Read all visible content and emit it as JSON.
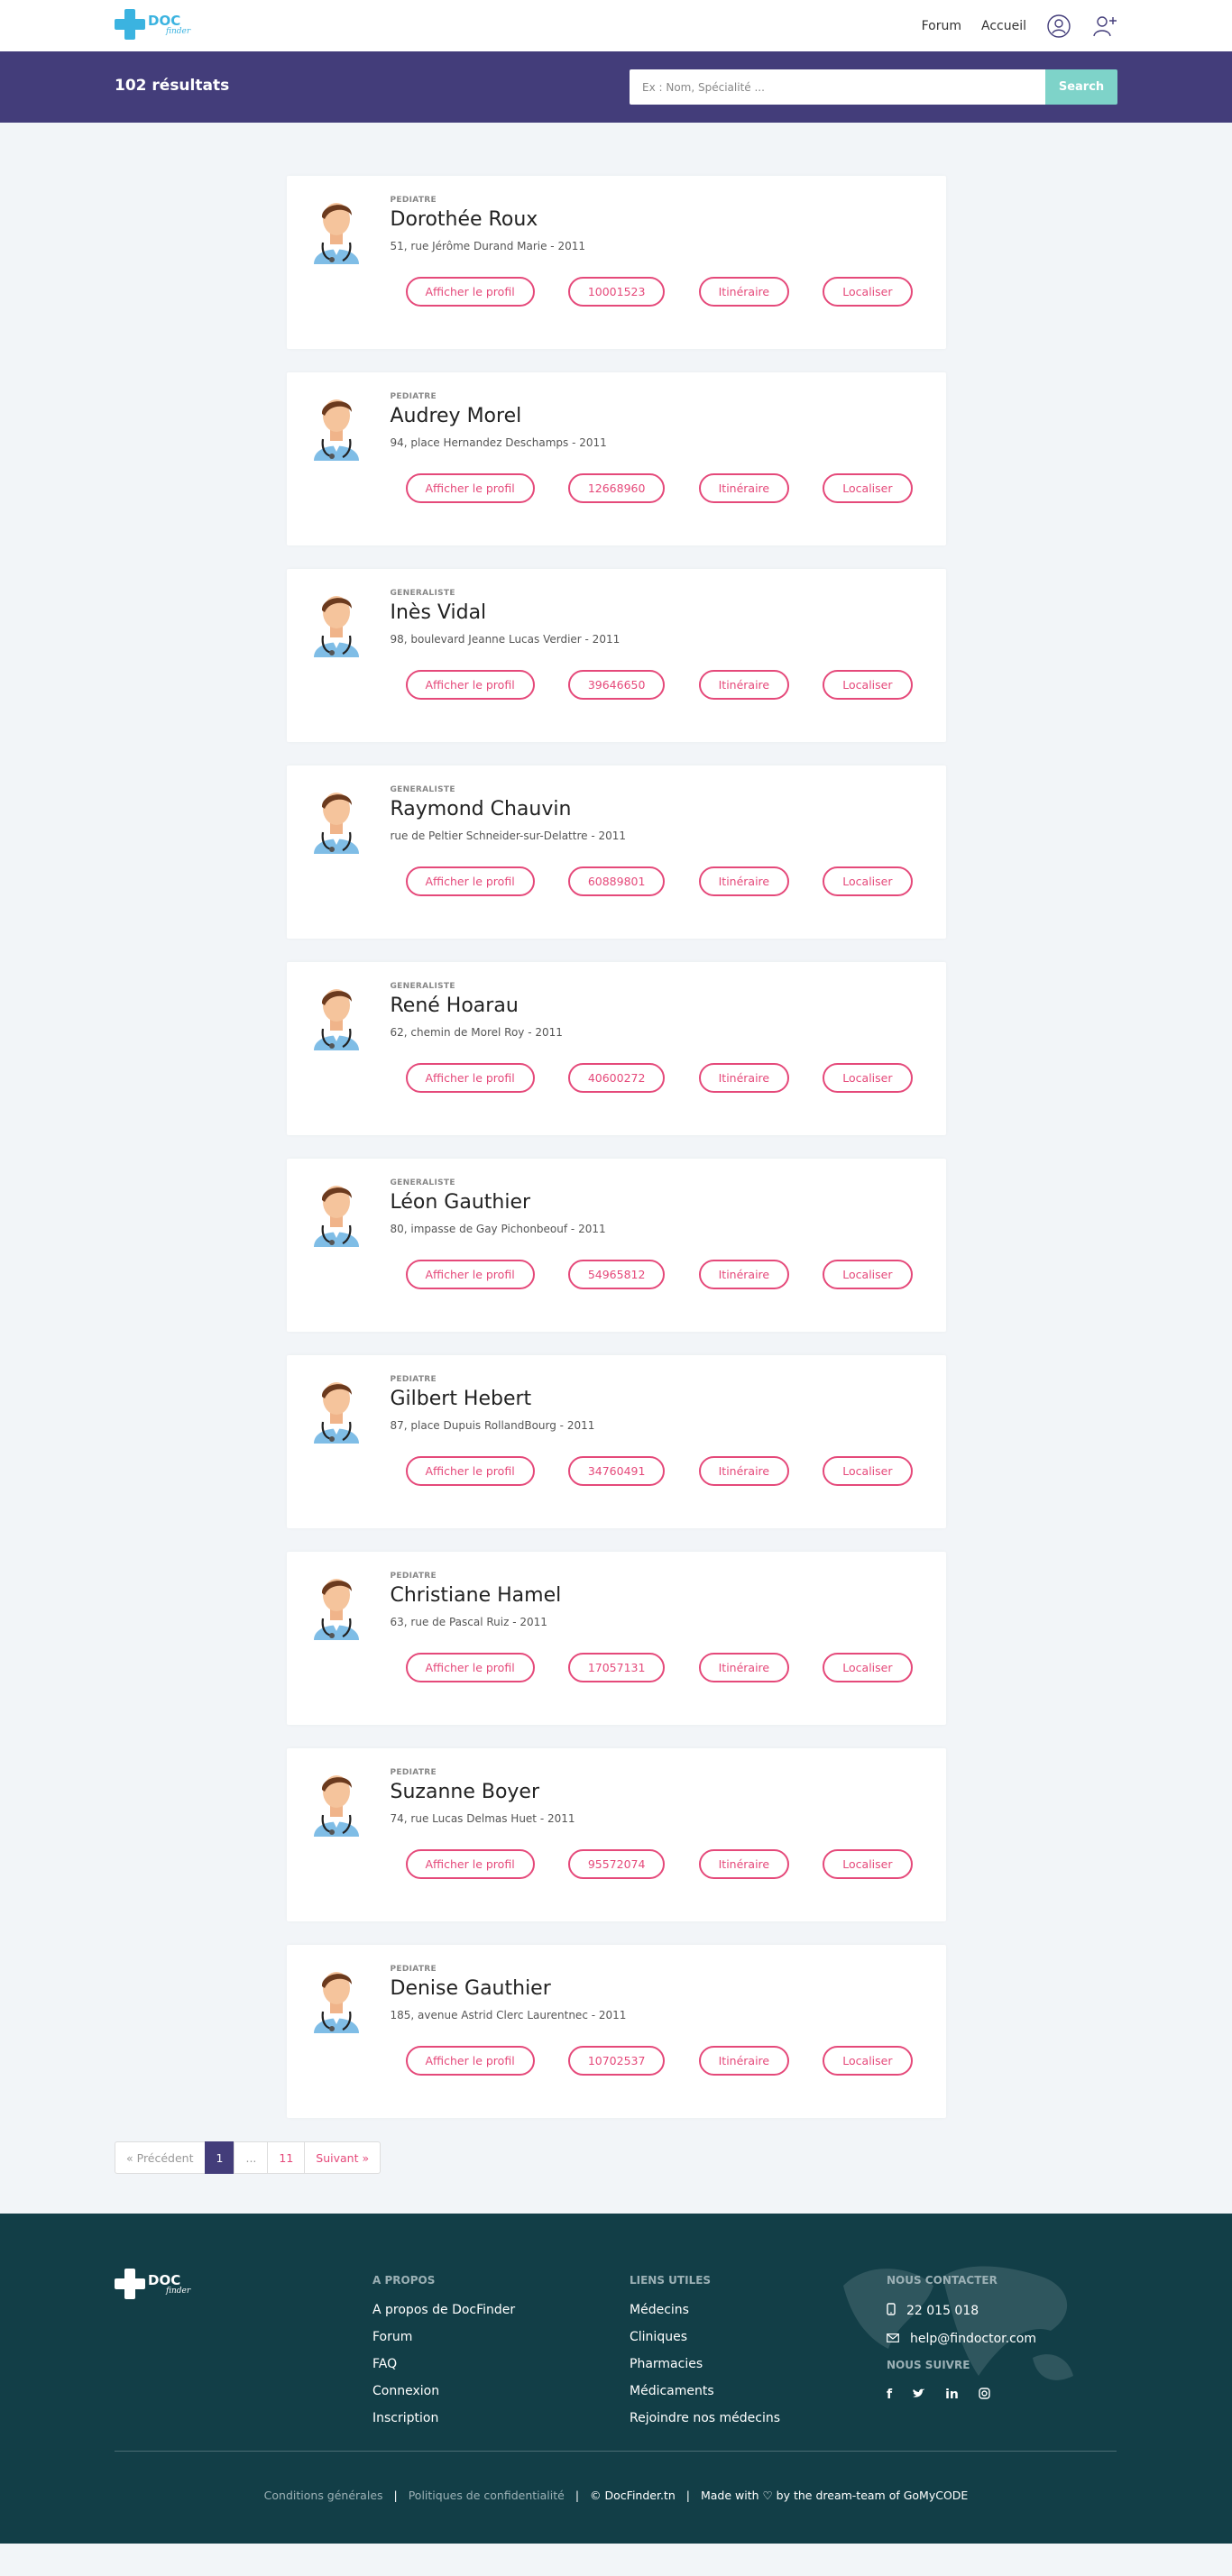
{
  "header": {
    "logo_text": "DOC",
    "logo_sub": "finder",
    "nav": {
      "forum": "Forum",
      "home": "Accueil"
    },
    "icons": [
      "user-icon",
      "add-user-icon"
    ]
  },
  "search": {
    "results_count": "102 résultats",
    "placeholder": "Ex : Nom, Spécialité ...",
    "button": "Search"
  },
  "labels": {
    "profile": "Afficher le profil",
    "itinerary": "Itinéraire",
    "locate": "Localiser"
  },
  "doctors": [
    {
      "specialty": "PEDIATRE",
      "name": "Dorothée Roux",
      "address": "51, rue Jérôme Durand Marie - 2011",
      "phone": "10001523"
    },
    {
      "specialty": "PEDIATRE",
      "name": "Audrey Morel",
      "address": "94, place Hernandez Deschamps - 2011",
      "phone": "12668960"
    },
    {
      "specialty": "GENERALISTE",
      "name": "Inès Vidal",
      "address": "98, boulevard Jeanne Lucas Verdier - 2011",
      "phone": "39646650"
    },
    {
      "specialty": "GENERALISTE",
      "name": "Raymond Chauvin",
      "address": "rue de Peltier Schneider-sur-Delattre - 2011",
      "phone": "60889801"
    },
    {
      "specialty": "GENERALISTE",
      "name": "René Hoarau",
      "address": "62, chemin de Morel Roy - 2011",
      "phone": "40600272"
    },
    {
      "specialty": "GENERALISTE",
      "name": "Léon Gauthier",
      "address": "80, impasse de Gay Pichonbeouf - 2011",
      "phone": "54965812"
    },
    {
      "specialty": "PEDIATRE",
      "name": "Gilbert Hebert",
      "address": "87, place Dupuis RollandBourg - 2011",
      "phone": "34760491"
    },
    {
      "specialty": "PEDIATRE",
      "name": "Christiane Hamel",
      "address": "63, rue de Pascal Ruiz - 2011",
      "phone": "17057131"
    },
    {
      "specialty": "PEDIATRE",
      "name": "Suzanne Boyer",
      "address": "74, rue Lucas Delmas Huet - 2011",
      "phone": "95572074"
    },
    {
      "specialty": "PEDIATRE",
      "name": "Denise Gauthier",
      "address": "185, avenue Astrid Clerc Laurentnec - 2011",
      "phone": "10702537"
    }
  ],
  "pagination": {
    "prev": "« Précédent",
    "current": "1",
    "dots": "...",
    "last": "11",
    "next": "Suivant »"
  },
  "footer": {
    "about_title": "A PROPOS",
    "about_links": [
      "A propos de DocFinder",
      "Forum",
      "FAQ",
      "Connexion",
      "Inscription"
    ],
    "useful_title": "LIENS UTILES",
    "useful_links": [
      "Médecins",
      "Cliniques",
      "Pharmacies",
      "Médicaments",
      "Rejoindre nos médecins"
    ],
    "contact_title": "NOUS CONTACTER",
    "phone": "22 015 018",
    "email": "help@findoctor.com",
    "follow_title": "NOUS SUIVRE",
    "socials": [
      "facebook-icon",
      "twitter-icon",
      "linkedin-icon",
      "instagram-icon"
    ],
    "bottom": {
      "terms": "Conditions générales",
      "privacy": "Politiques de confidentialité",
      "copyright": "© DocFinder.tn",
      "made": "Made with ♡ by the dream-team of GoMyCODE"
    }
  },
  "colors": {
    "primary": "#433d7a",
    "accent": "#e5497a",
    "search_button": "#7ed3c9",
    "footer_bg": "#123e47",
    "logo": "#3bb3e0"
  }
}
